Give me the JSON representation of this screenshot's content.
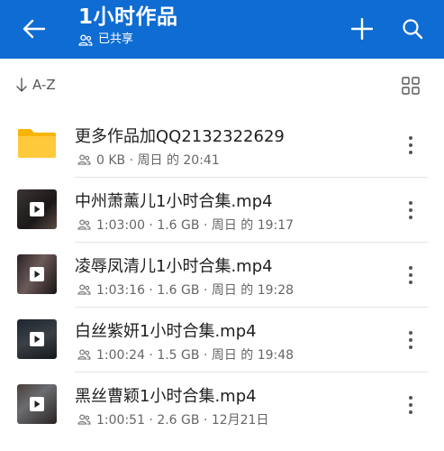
{
  "header": {
    "title": "1小时作品",
    "subtitle": "已共享",
    "back_icon": "arrow-left-icon",
    "add_icon": "plus-icon",
    "search_icon": "search-icon",
    "background": "#0f6cd2"
  },
  "sort": {
    "label": "A-Z",
    "icon": "arrow-down-icon",
    "view_icon": "grid-view-icon"
  },
  "items": [
    {
      "name": "更多作品加QQ2132322629",
      "meta": "0 KB · 周日 的 20:41",
      "type": "folder"
    },
    {
      "name": "中州萧薰儿1小时合集.mp4",
      "meta": "1:03:00 · 1.6 GB · 周日 的 19:17",
      "type": "video"
    },
    {
      "name": "凌辱凤清儿1小时合集.mp4",
      "meta": "1:03:16 · 1.6 GB · 周日 的 19:28",
      "type": "video"
    },
    {
      "name": "白丝紫妍1小时合集.mp4",
      "meta": "1:00:24 · 1.5 GB · 周日 的 19:48",
      "type": "video"
    },
    {
      "name": "黑丝曹颖1小时合集.mp4",
      "meta": "1:00:51 · 2.6 GB · 12月21日",
      "type": "video"
    }
  ]
}
